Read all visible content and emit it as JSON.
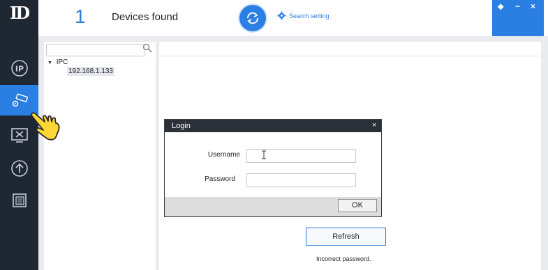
{
  "app": {
    "logo_text": "ID"
  },
  "header": {
    "device_count": "1",
    "devices_found_label": "Devices found",
    "search_setting_label": "Search setting"
  },
  "window_controls": {
    "pin": "⬥",
    "minimize": "−",
    "close": "×"
  },
  "sidebar": {
    "items": [
      {
        "icon": "ip-icon"
      },
      {
        "icon": "camera-settings-icon",
        "active": true
      },
      {
        "icon": "tools-icon"
      },
      {
        "icon": "upgrade-icon"
      },
      {
        "icon": "documents-icon"
      }
    ]
  },
  "tree": {
    "root": "IPC",
    "children": [
      "192.168.1.133"
    ]
  },
  "login_dialog": {
    "title": "Login",
    "close": "×",
    "username_label": "Username",
    "password_label": "Password",
    "username_value": "",
    "password_value": "",
    "ok_label": "OK"
  },
  "main": {
    "refresh_label": "Refresh",
    "status_message": "Incorrect password."
  },
  "colors": {
    "accent": "#2b7fe3",
    "sidebar": "#1f2733",
    "dialog_title": "#2c3139"
  }
}
